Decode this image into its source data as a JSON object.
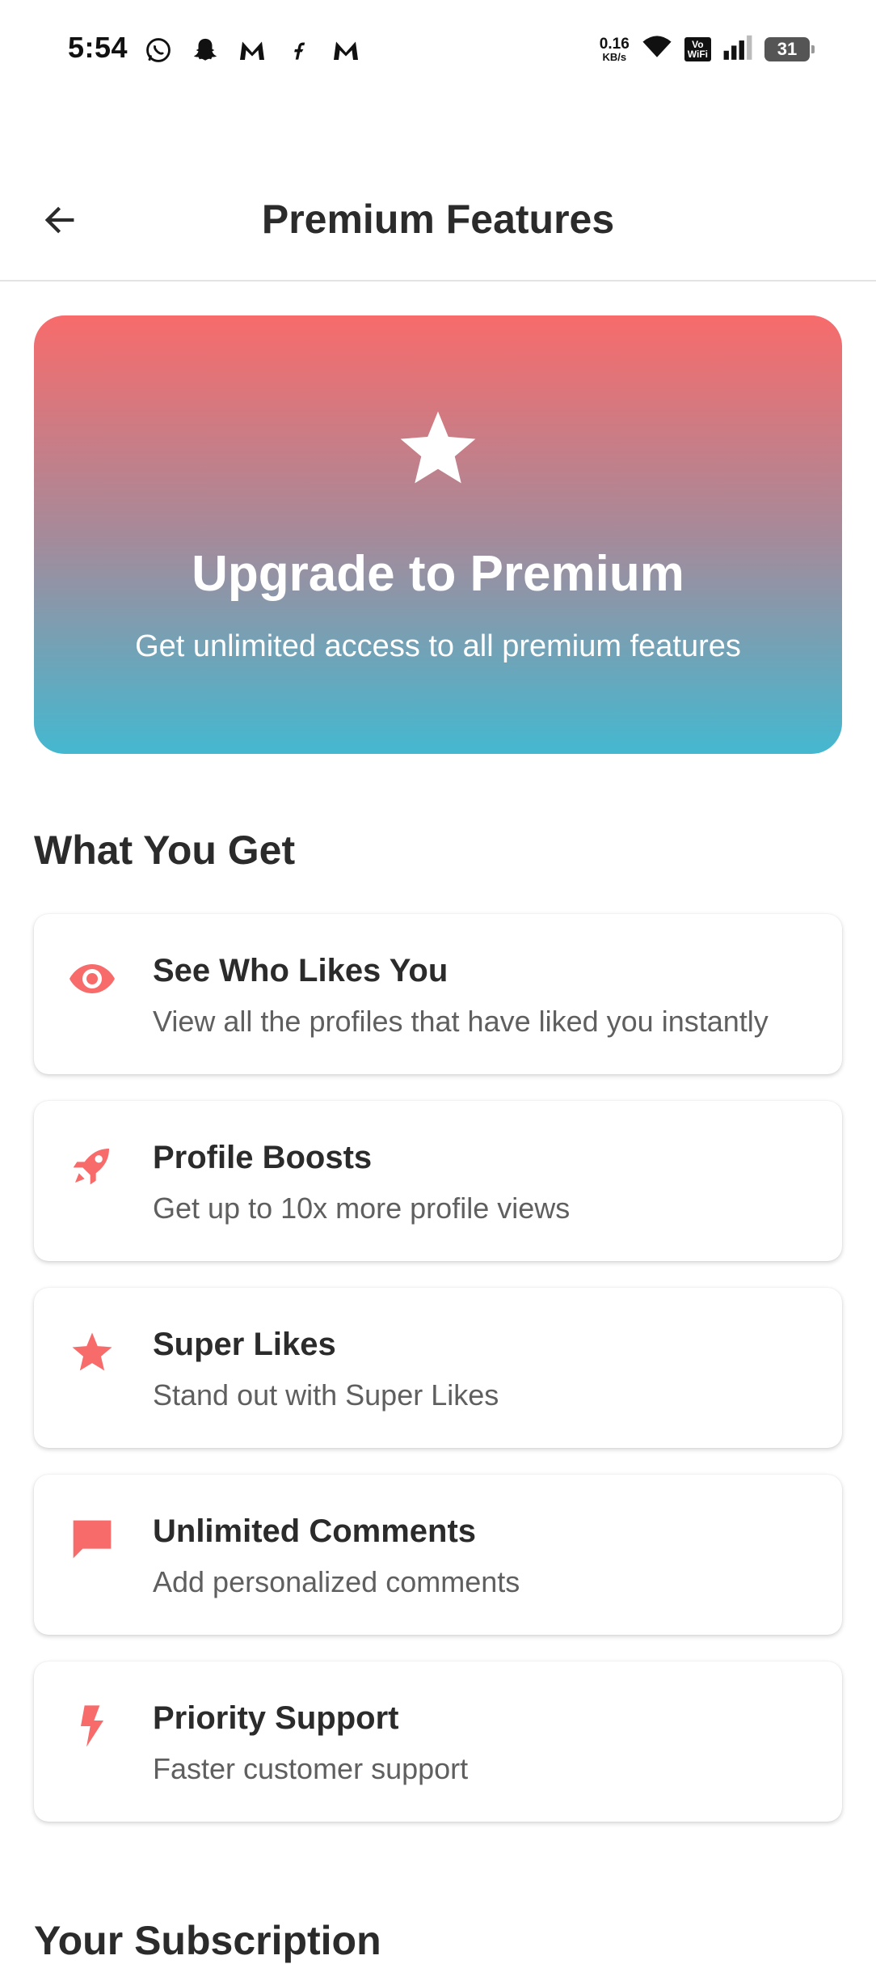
{
  "status_bar": {
    "time": "5:54",
    "net_speed_value": "0.16",
    "net_speed_unit": "KB/s",
    "vowifi_line1": "Vo",
    "vowifi_line2": "WiFi",
    "battery": "31",
    "left_icons": [
      "whatsapp-icon",
      "snapchat-icon",
      "gmail-icon",
      "fb-icon",
      "gmail-icon"
    ]
  },
  "app_bar": {
    "title": "Premium Features",
    "back_icon": "arrow-left-icon"
  },
  "banner": {
    "icon": "star-icon",
    "title": "Upgrade to Premium",
    "subtitle": "Get unlimited access to all premium features",
    "gradient_top": "#f86b6b",
    "gradient_bottom": "#44b8d0"
  },
  "features_section": {
    "heading": "What You Get",
    "items": [
      {
        "icon": "eye-icon",
        "title": "See Who Likes You",
        "description": "View all the profiles that have liked you instantly"
      },
      {
        "icon": "rocket-icon",
        "title": "Profile Boosts",
        "description": "Get up to 10x more profile views"
      },
      {
        "icon": "star-icon",
        "title": "Super Likes",
        "description": "Stand out with Super Likes"
      },
      {
        "icon": "comment-icon",
        "title": "Unlimited Comments",
        "description": "Add personalized comments"
      },
      {
        "icon": "bolt-icon",
        "title": "Priority Support",
        "description": "Faster customer support"
      }
    ]
  },
  "subscription_section": {
    "heading": "Your Subscription"
  },
  "colors": {
    "accent": "#f86b6b",
    "text_primary": "#2b2b2b",
    "text_secondary": "#5f5f5f"
  }
}
